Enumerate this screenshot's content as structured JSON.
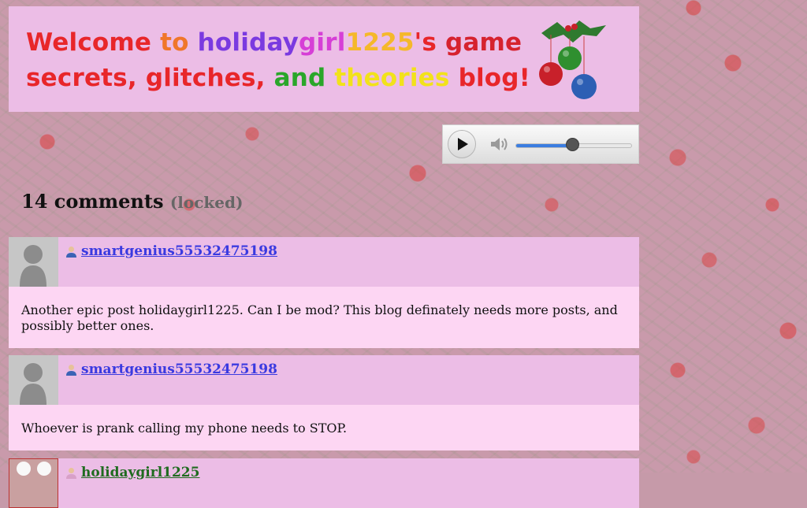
{
  "banner": {
    "line1": [
      {
        "text": "Welcome ",
        "color": "#e8262a"
      },
      {
        "text": "to ",
        "color": "#f0762a"
      },
      {
        "text": "holiday",
        "color": "#7a3ae0"
      },
      {
        "text": "girl",
        "color": "#d63fd6"
      },
      {
        "text": "1225",
        "color": "#f5b82a"
      },
      {
        "text": "'s ",
        "color": "#e8262a"
      },
      {
        "text": "game",
        "color": "#d6222e"
      }
    ],
    "line2": [
      {
        "text": "secrets, ",
        "color": "#e8262a"
      },
      {
        "text": "glitches, ",
        "color": "#e8262a"
      },
      {
        "text": "and ",
        "color": "#2aa62a"
      },
      {
        "text": "theories ",
        "color": "#f2e21a"
      },
      {
        "text": "blog!",
        "color": "#e8262a"
      }
    ],
    "ornament_colors": [
      "#c8202a",
      "#2f8f2f",
      "#2d5fb4"
    ]
  },
  "player": {
    "volume_fraction": 0.49
  },
  "comments_header": {
    "count": "14 comments",
    "status": "(locked)"
  },
  "comments": [
    {
      "user": "smartgenius55532475198",
      "text": "Another epic post holidaygirl1225. Can I be mod? This blog definately needs more posts, and possibly better ones."
    },
    {
      "user": "smartgenius55532475198",
      "text": "Whoever is prank calling my phone needs to STOP."
    },
    {
      "user": "holidaygirl1225",
      "text": ""
    }
  ]
}
